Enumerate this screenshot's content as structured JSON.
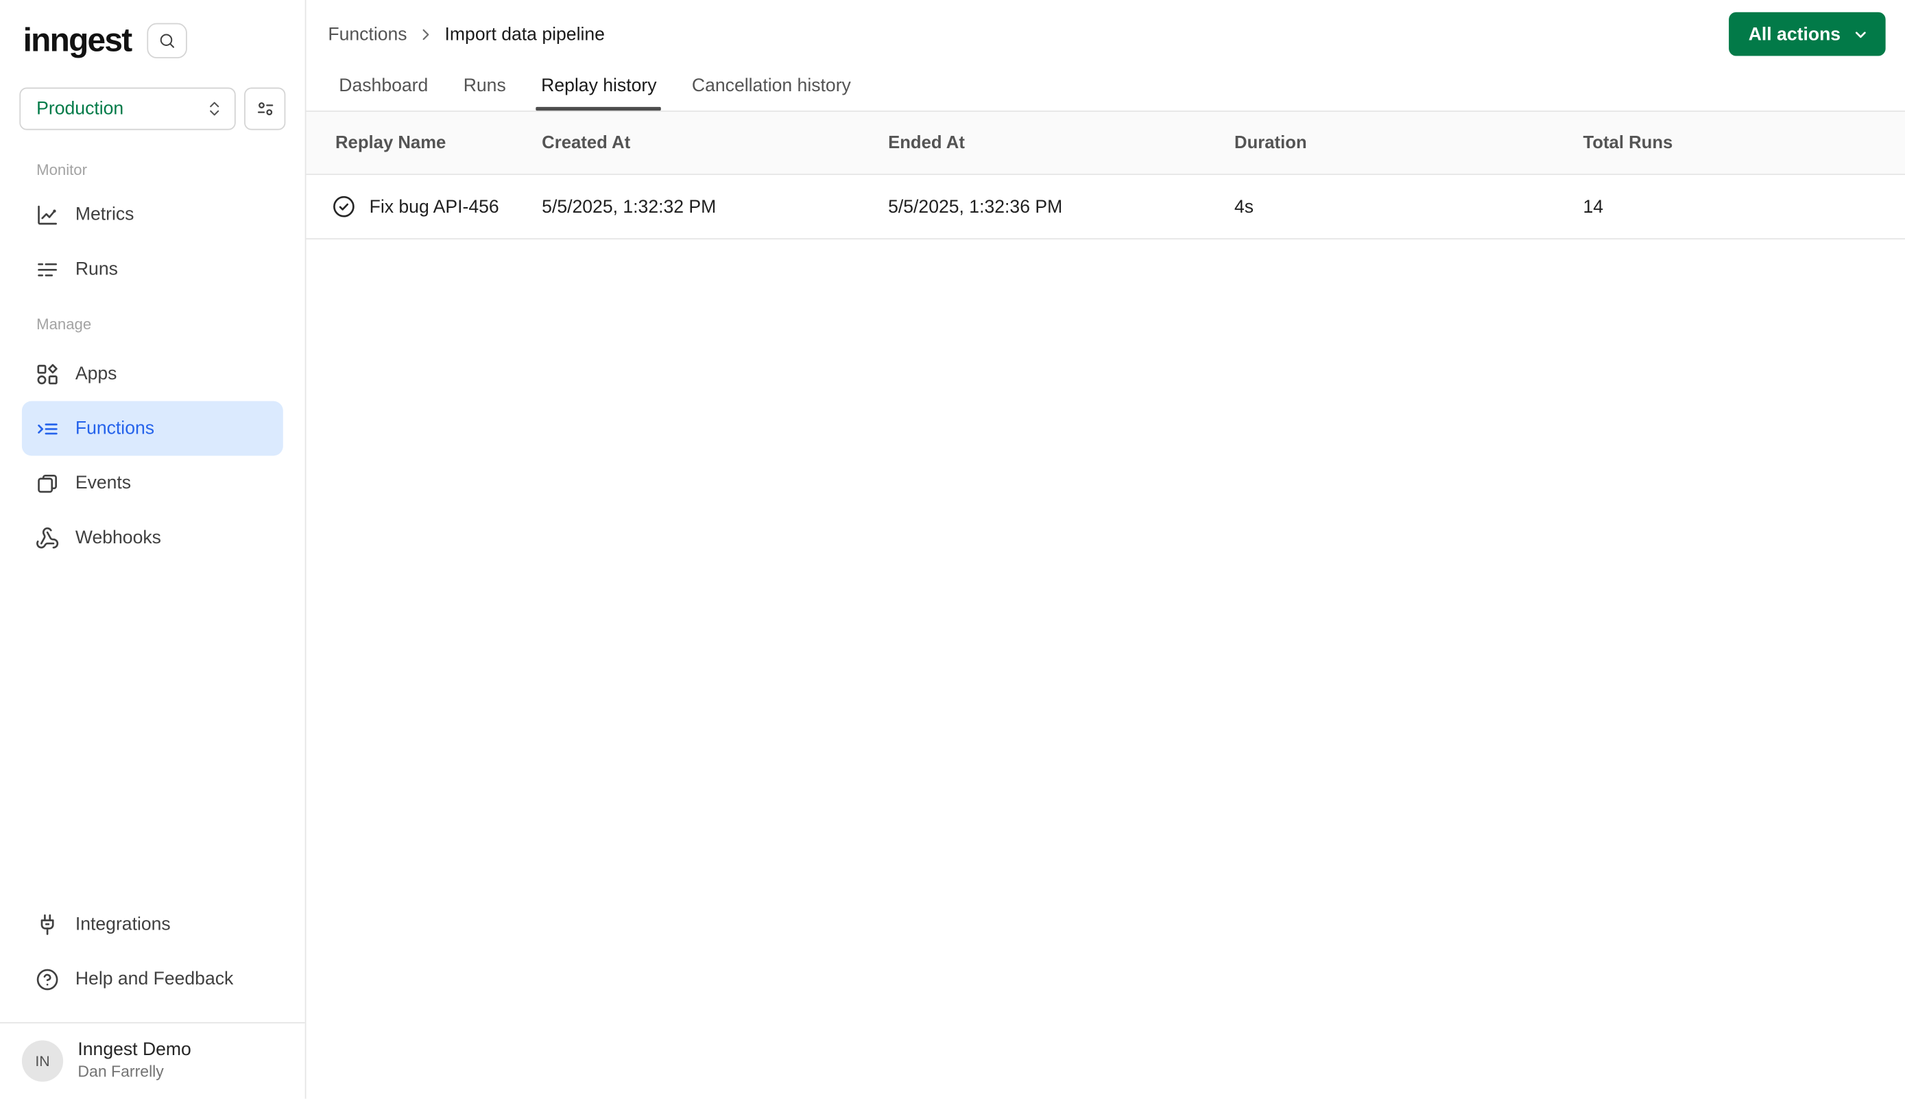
{
  "app": {
    "logo_text": "inngest"
  },
  "sidebar": {
    "env_selector": {
      "value": "Production"
    },
    "sections": [
      {
        "label": "Monitor",
        "items": [
          {
            "label": "Metrics"
          },
          {
            "label": "Runs"
          }
        ]
      },
      {
        "label": "Manage",
        "items": [
          {
            "label": "Apps"
          },
          {
            "label": "Functions"
          },
          {
            "label": "Events"
          },
          {
            "label": "Webhooks"
          }
        ]
      }
    ],
    "footer_items": [
      {
        "label": "Integrations"
      },
      {
        "label": "Help and Feedback"
      }
    ],
    "user": {
      "initials": "IN",
      "org_name": "Inngest Demo",
      "user_name": "Dan Farrelly"
    }
  },
  "main": {
    "breadcrumb": {
      "parent": "Functions",
      "current": "Import data pipeline"
    },
    "actions_button": {
      "label": "All actions"
    },
    "tabs": [
      {
        "label": "Dashboard"
      },
      {
        "label": "Runs"
      },
      {
        "label": "Replay history"
      },
      {
        "label": "Cancellation history"
      }
    ],
    "active_tab": "Replay history",
    "table": {
      "columns": [
        "Replay Name",
        "Created At",
        "Ended At",
        "Duration",
        "Total Runs"
      ],
      "rows": [
        {
          "replay_name": "Fix bug API-456",
          "created_at": "5/5/2025, 1:32:32 PM",
          "ended_at": "5/5/2025, 1:32:36 PM",
          "duration": "4s",
          "total_runs": "14"
        }
      ]
    }
  },
  "colors": {
    "accent_green": "#027a48",
    "active_blue": "#2563eb",
    "active_blue_bg": "#dbeafe",
    "border": "#e5e5e5"
  }
}
